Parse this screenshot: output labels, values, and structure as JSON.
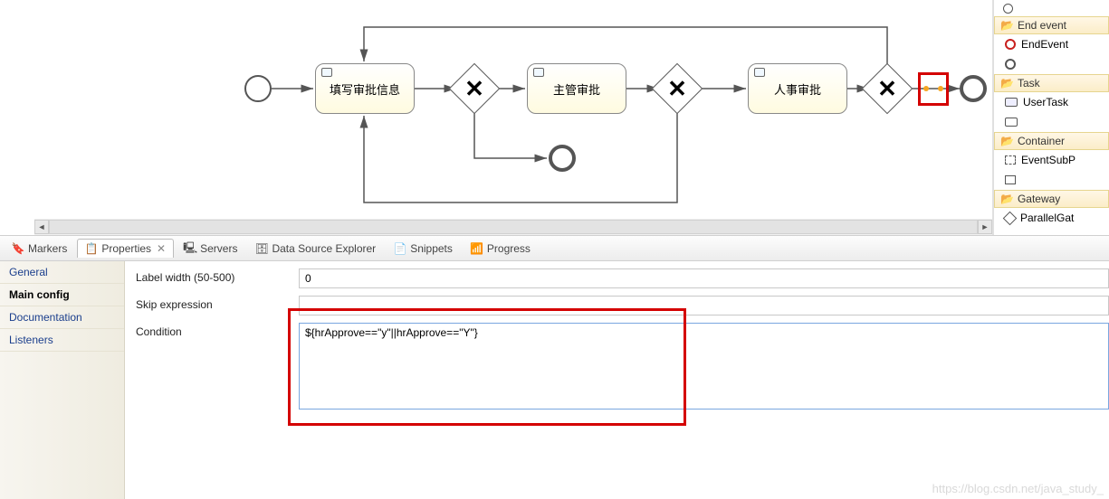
{
  "canvas": {
    "task1": "填写审批信息",
    "task2": "主管审批",
    "task3": "人事审批"
  },
  "palette": {
    "truncated_top": "…",
    "cat_end": "End event",
    "item_endevent": "EndEvent",
    "item_end_trunc": "…",
    "cat_task": "Task",
    "item_usertask": "UserTask",
    "item_task_trunc": "…",
    "cat_container": "Container",
    "item_eventsubp": "EventSubP",
    "item_container_trunc": "…",
    "cat_gateway": "Gateway",
    "item_parallelgat": "ParallelGat"
  },
  "tabs": {
    "markers": "Markers",
    "properties": "Properties",
    "servers": "Servers",
    "dse": "Data Source Explorer",
    "snippets": "Snippets",
    "progress": "Progress"
  },
  "propside": {
    "general": "General",
    "main": "Main config",
    "doc": "Documentation",
    "listeners": "Listeners"
  },
  "props": {
    "label_width_label": "Label width (50-500)",
    "label_width_value": "0",
    "skip_label": "Skip expression",
    "skip_value": "",
    "condition_label": "Condition",
    "condition_value": "${hrApprove==\"y\"||hrApprove==\"Y\"}"
  },
  "watermark": "https://blog.csdn.net/java_study_"
}
